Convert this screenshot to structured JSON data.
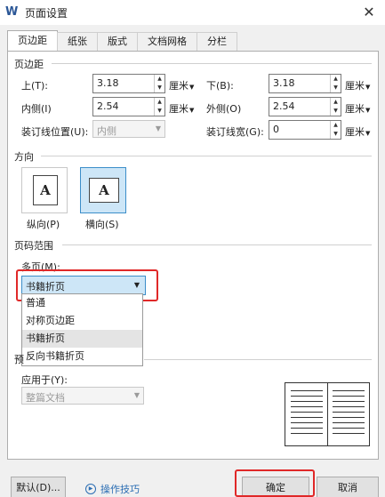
{
  "window": {
    "title": "页面设置",
    "app_icon_letter": "W",
    "close_glyph": "✕"
  },
  "tabs": [
    {
      "label": "页边距",
      "active": true
    },
    {
      "label": "纸张",
      "active": false
    },
    {
      "label": "版式",
      "active": false
    },
    {
      "label": "文档网格",
      "active": false
    },
    {
      "label": "分栏",
      "active": false
    }
  ],
  "margins": {
    "section_label": "页边距",
    "top": {
      "label": "上(T):",
      "value": "3.18",
      "unit": "厘米"
    },
    "bottom": {
      "label": "下(B):",
      "value": "3.18",
      "unit": "厘米"
    },
    "inside": {
      "label": "内侧(I)",
      "value": "2.54",
      "unit": "厘米"
    },
    "outside": {
      "label": "外侧(O)",
      "value": "2.54",
      "unit": "厘米"
    },
    "gutter_position": {
      "label": "装订线位置(U):",
      "value": "内侧"
    },
    "gutter_width": {
      "label": "装订线宽(G):",
      "value": "0",
      "unit": "厘米"
    }
  },
  "orientation": {
    "section_label": "方向",
    "portrait": {
      "label": "纵向(P)",
      "glyph": "A"
    },
    "landscape": {
      "label": "横向(S)",
      "glyph": "A",
      "selected": true
    }
  },
  "page_range": {
    "section_label": "页码范围",
    "multiple_pages_label": "多页(M):",
    "selected": "书籍折页",
    "options": [
      "普通",
      "对称页边距",
      "书籍折页",
      "反向书籍折页"
    ],
    "hovered_option": "书籍折页"
  },
  "preview": {
    "section_label_partial": "预",
    "apply_to_label": "应用于(Y):",
    "apply_to_value": "整篇文档"
  },
  "footer": {
    "default_button": "默认(D)...",
    "help_link": "操作技巧",
    "ok_button": "确定",
    "cancel_button": "取消"
  },
  "colors": {
    "accent": "#3c8ec9",
    "highlight": "#e02828",
    "selected_bg": "#cde6f7",
    "link": "#2a6db3"
  }
}
